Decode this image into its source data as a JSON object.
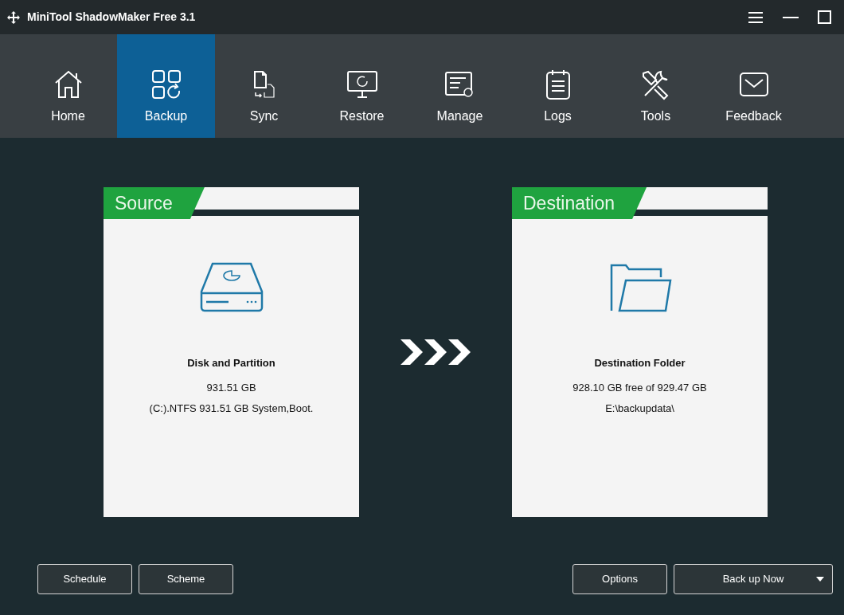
{
  "window": {
    "title": "MiniTool ShadowMaker Free 3.1"
  },
  "nav": [
    {
      "label": "Home",
      "selected": false
    },
    {
      "label": "Backup",
      "selected": true
    },
    {
      "label": "Sync",
      "selected": false
    },
    {
      "label": "Restore",
      "selected": false
    },
    {
      "label": "Manage",
      "selected": false
    },
    {
      "label": "Logs",
      "selected": false
    },
    {
      "label": "Tools",
      "selected": false
    },
    {
      "label": "Feedback",
      "selected": false
    }
  ],
  "source": {
    "header": "Source",
    "title": "Disk and Partition",
    "lines": [
      "931.51 GB",
      "(C:).NTFS 931.51 GB System,Boot."
    ]
  },
  "destination": {
    "header": "Destination",
    "title": "Destination Folder",
    "lines": [
      "928.10 GB free of 929.47 GB",
      "E:\\backupdata\\"
    ]
  },
  "left_buttons": [
    "Schedule",
    "Scheme"
  ],
  "right_buttons": {
    "options": "Options",
    "backup": "Back up Now"
  }
}
